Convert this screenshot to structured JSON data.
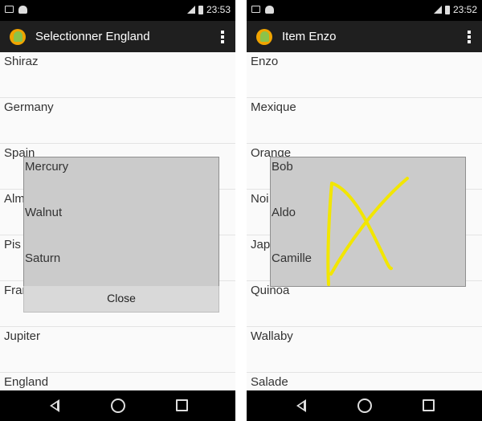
{
  "left_screen": {
    "status_time": "23:53",
    "title": "Selectionner England",
    "list_items": [
      "Shiraz",
      "Germany",
      "Spain",
      "Alm",
      "Pis",
      "France",
      "Jupiter",
      "England"
    ],
    "dialog": {
      "items": [
        "Mercury",
        "Walnut",
        "Saturn"
      ],
      "close_label": "Close"
    }
  },
  "right_screen": {
    "status_time": "23:52",
    "title": "Item Enzo",
    "list_items": [
      "Enzo",
      "Mexique",
      "Orange",
      "Noi",
      "Jap",
      "Quinoa",
      "Wallaby",
      "Salade"
    ],
    "dialog": {
      "items": [
        "Bob",
        "Aldo",
        "Camille"
      ],
      "drawing_color": "#f2e600"
    }
  },
  "colors": {
    "status_bar": "#000000",
    "action_bar": "#1f1f1f",
    "list_background": "#fafafa",
    "dialog_background": "#cbcbcb",
    "app_icon_gear": "#f0a400",
    "app_icon_droid": "#8bc34a"
  },
  "icons": {
    "status_left": [
      "screenshot-icon",
      "android-notification-icon"
    ],
    "status_right": [
      "signal-icon",
      "battery-icon"
    ],
    "navigation": [
      "back-icon",
      "home-icon",
      "recent-apps-icon"
    ],
    "action_bar": [
      "app-icon",
      "overflow-menu-icon"
    ]
  }
}
